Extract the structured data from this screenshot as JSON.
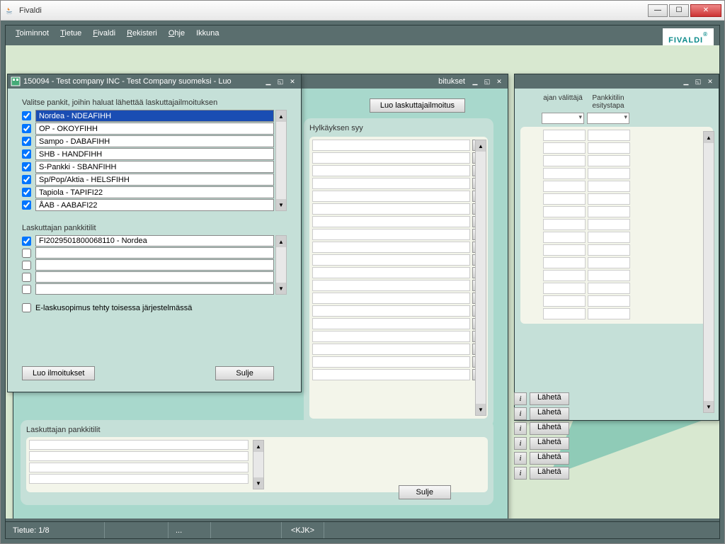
{
  "window": {
    "title": "Fivaldi"
  },
  "menu": {
    "toiminnot": "Toiminnot",
    "tietue": "Tietue",
    "fivaldi": "Fivaldi",
    "rekisteri": "Rekisteri",
    "ohje": "Ohje",
    "ikkuna": "Ikkuna"
  },
  "logo": "FIVALDI",
  "status": {
    "tietue": "Tietue: 1/8",
    "dots": "...",
    "kjk": "<KJK>"
  },
  "front": {
    "title": "150094 - Test company INC - Test Company suomeksi - Luo",
    "section1": "Valitse pankit, joihin haluat lähettää laskuttajailmoituksen",
    "banks": [
      "Nordea - NDEAFIHH",
      "OP - OKOYFIHH",
      "Sampo - DABAFIHH",
      "SHB - HANDFIHH",
      "S-Pankki - SBANFIHH",
      "Sp/Pop/Aktia - HELSFIHH",
      "Tapiola - TAPIFI22",
      "ÅAB - AABAFI22"
    ],
    "section2": "Laskuttajan pankkitilit",
    "accounts": [
      "FI2029501800068110 - Nordea",
      "",
      "",
      "",
      ""
    ],
    "elasku": "E-laskusopimus tehty toisessa järjestelmässä",
    "btn_create": "Luo ilmoitukset",
    "btn_close": "Sulje"
  },
  "mid": {
    "title_suffix": "bitukset",
    "btn_top": "Luo laskuttajailmoitus",
    "reject_label": "Hylkäyksen syy",
    "bottom_label": "Laskuttajan pankkitilit",
    "btn_close": "Sulje"
  },
  "right": {
    "hdr1": "ajan välittäjä",
    "hdr2": "Pankkitilin esitystapa",
    "info": "i",
    "laheta": "Lähetä"
  }
}
